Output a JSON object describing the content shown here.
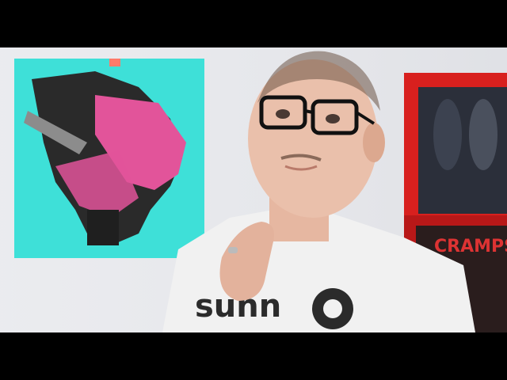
{
  "video": {
    "shirt_text": "sunn",
    "shelf_record_text": "CRAMPS"
  },
  "colors": {
    "wall": "#e7e8ec",
    "poster_bg": "#3ee0d8",
    "poster_pink": "#e2549a",
    "shelf_frame": "#d8201e",
    "shirt": "#f1f1f1",
    "skin": "#e6b7a1"
  }
}
